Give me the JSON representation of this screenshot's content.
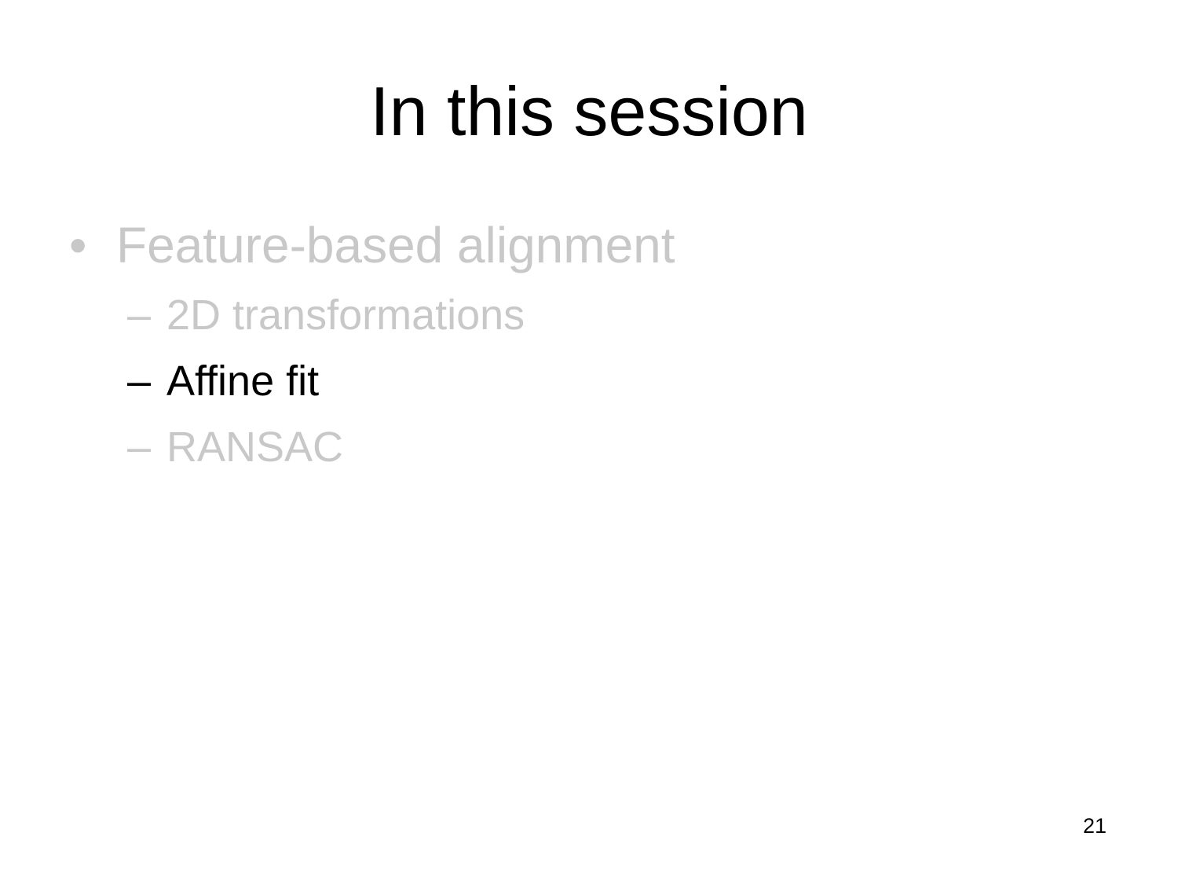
{
  "slide": {
    "title": "In this session",
    "bullet": {
      "marker": "•",
      "text": "Feature-based alignment"
    },
    "sub_items": [
      {
        "marker": "–",
        "text": "2D transformations",
        "state": "dim"
      },
      {
        "marker": "–",
        "text": "Affine fit",
        "state": "active"
      },
      {
        "marker": "–",
        "text": "RANSAC",
        "state": "dim"
      }
    ],
    "page_number": "21"
  },
  "colors": {
    "active_text": "#000000",
    "dim_text": "#c8c8c8",
    "background": "#ffffff"
  }
}
